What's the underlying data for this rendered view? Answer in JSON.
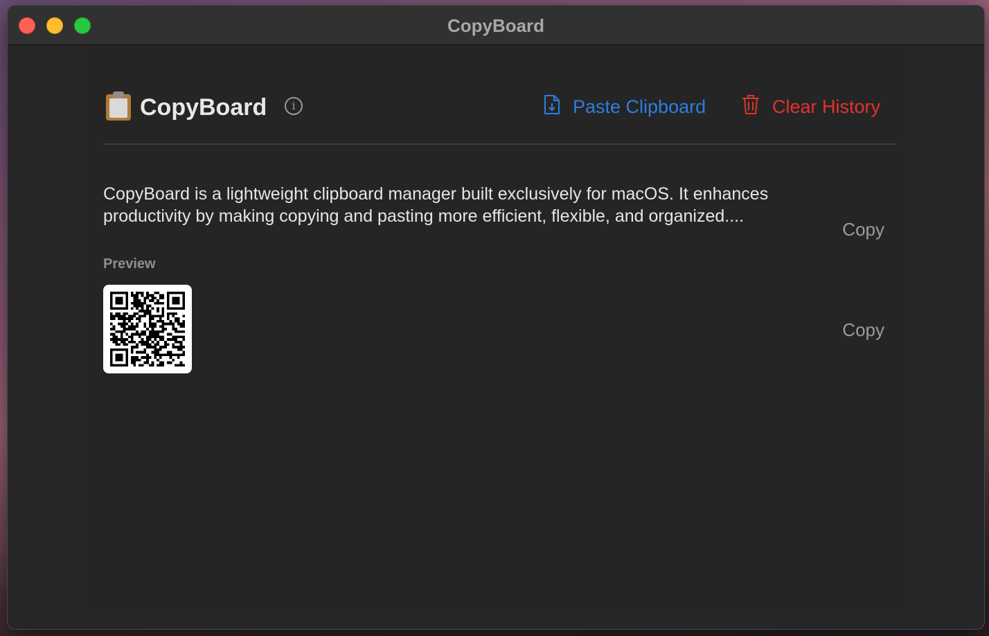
{
  "window": {
    "title": "CopyBoard"
  },
  "header": {
    "app_title": "CopyBoard",
    "app_icon": "clipboard-icon",
    "info_icon": "info-icon",
    "paste_label": "Paste Clipboard",
    "paste_icon": "document-download-icon",
    "clear_label": "Clear History",
    "clear_icon": "trash-icon"
  },
  "history": {
    "items": [
      {
        "type": "text",
        "text": "CopyBoard is a lightweight clipboard manager built exclusively for macOS. It enhances productivity by making copying and pasting more efficient, flexible, and organized....",
        "preview_label": "Preview",
        "copy_label": "Copy"
      },
      {
        "type": "image",
        "image": "qr-code",
        "copy_label": "Copy"
      }
    ]
  },
  "colors": {
    "accent_blue": "#2f7de0",
    "destructive_red": "#e2322d",
    "window_bg": "#262626"
  }
}
